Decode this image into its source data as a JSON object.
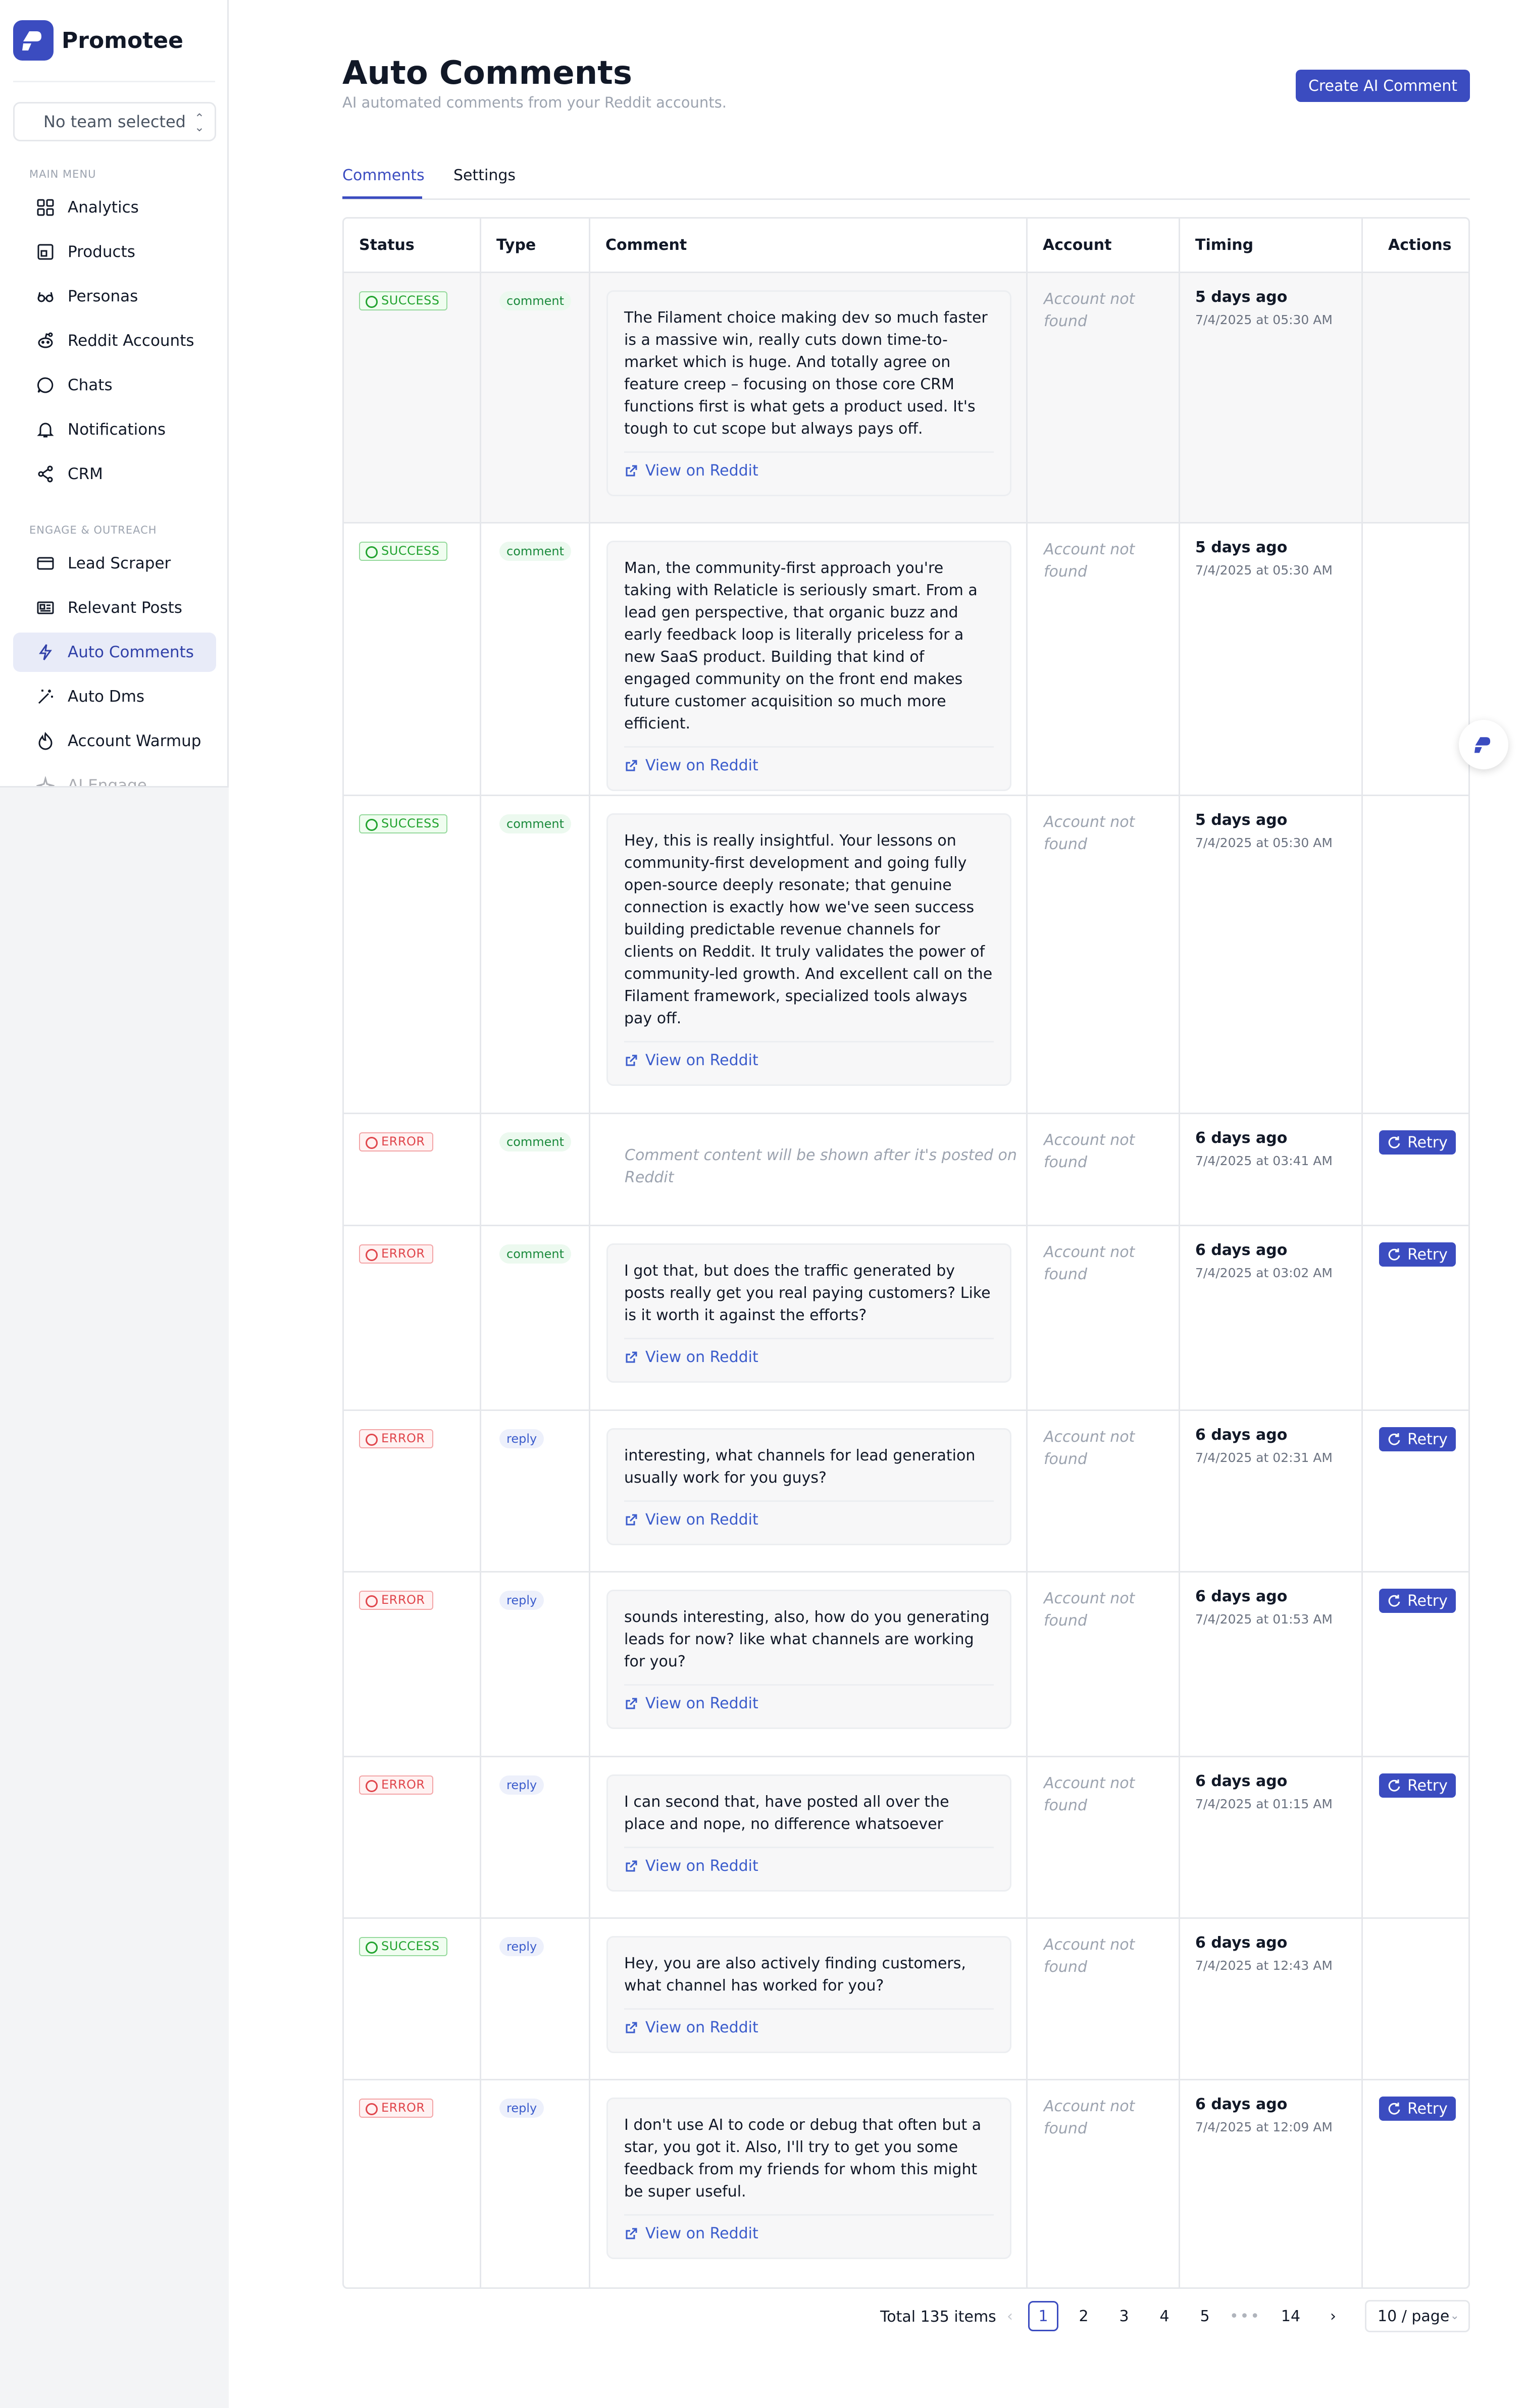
{
  "app": {
    "name": "Promotee"
  },
  "team_selector": {
    "value": "No team selected"
  },
  "sidebar": {
    "main_menu_label": "MAIN MENU",
    "engage_label": "ENGAGE & OUTREACH",
    "items": [
      {
        "label": "Analytics",
        "icon": "grid-icon"
      },
      {
        "label": "Products",
        "icon": "box-icon"
      },
      {
        "label": "Personas",
        "icon": "glasses-icon"
      },
      {
        "label": "Reddit Accounts",
        "icon": "reddit-icon"
      },
      {
        "label": "Chats",
        "icon": "chat-bubble-icon"
      },
      {
        "label": "Notifications",
        "icon": "bell-icon"
      },
      {
        "label": "CRM",
        "icon": "share-nodes-icon"
      },
      {
        "label": "Lead Scraper",
        "icon": "credit-card-icon"
      },
      {
        "label": "Relevant Posts",
        "icon": "news-icon"
      },
      {
        "label": "Auto Comments",
        "icon": "bolt-icon"
      },
      {
        "label": "Auto Dms",
        "icon": "magic-wand-icon"
      },
      {
        "label": "Account Warmup",
        "icon": "flame-icon"
      },
      {
        "label": "AI Engage",
        "icon": "sparkle-icon"
      }
    ]
  },
  "page": {
    "title": "Auto Comments",
    "subtitle": "AI automated comments from your Reddit accounts.",
    "create_button": "Create AI Comment",
    "tabs": [
      "Comments",
      "Settings"
    ]
  },
  "table": {
    "headers": [
      "Status",
      "Type",
      "Comment",
      "Account",
      "Timing",
      "Actions"
    ],
    "link_label": "View on Reddit",
    "retry_label": "Retry",
    "rows": [
      {
        "status": "SUCCESS",
        "type": "comment",
        "comment": "The Filament choice making dev so much faster is a massive win, really cuts down time-to-market which is huge. And totally agree on feature creep – focusing on those core CRM functions first is what gets a product used. It's tough to cut scope but always pays off.",
        "account": "Account not found",
        "relative": "5 days ago",
        "absolute": "7/4/2025 at 05:30 AM"
      },
      {
        "status": "SUCCESS",
        "type": "comment",
        "comment": "Man, the community-first approach you're taking with Relaticle is seriously smart. From a lead gen perspective, that organic buzz and early feedback loop is literally priceless for a new SaaS product. Building that kind of engaged community on the front end makes future customer acquisition so much more efficient.",
        "account": "Account not found",
        "relative": "5 days ago",
        "absolute": "7/4/2025 at 05:30 AM"
      },
      {
        "status": "SUCCESS",
        "type": "comment",
        "comment": "Hey, this is really insightful. Your lessons on community-first development and going fully open-source deeply resonate; that genuine connection is exactly how we've seen success building predictable revenue channels for clients on Reddit. It truly validates the power of community-led growth. And excellent call on the Filament framework, specialized tools always pay off.",
        "account": "Account not found",
        "relative": "5 days ago",
        "absolute": "7/4/2025 at 05:30 AM"
      },
      {
        "status": "ERROR",
        "type": "comment",
        "placeholder": "Comment content will be shown after it's posted on Reddit",
        "account": "Account not found",
        "relative": "6 days ago",
        "absolute": "7/4/2025 at 03:41 AM"
      },
      {
        "status": "ERROR",
        "type": "comment",
        "comment": "I got that, but does the traffic generated by posts really get you real paying customers? Like is it worth it against the efforts?",
        "account": "Account not found",
        "relative": "6 days ago",
        "absolute": "7/4/2025 at 03:02 AM"
      },
      {
        "status": "ERROR",
        "type": "reply",
        "comment": "interesting, what channels for lead generation usually work for you guys?",
        "account": "Account not found",
        "relative": "6 days ago",
        "absolute": "7/4/2025 at 02:31 AM"
      },
      {
        "status": "ERROR",
        "type": "reply",
        "comment": "sounds interesting, also, how do you generating leads for now? like what channels are working for you?",
        "account": "Account not found",
        "relative": "6 days ago",
        "absolute": "7/4/2025 at 01:53 AM"
      },
      {
        "status": "ERROR",
        "type": "reply",
        "comment": "I can second that, have posted all over the place and nope, no difference whatsoever",
        "account": "Account not found",
        "relative": "6 days ago",
        "absolute": "7/4/2025 at 01:15 AM"
      },
      {
        "status": "SUCCESS",
        "type": "reply",
        "comment": "Hey, you are also actively finding customers, what channel has worked for you?",
        "account": "Account not found",
        "relative": "6 days ago",
        "absolute": "7/4/2025 at 12:43 AM"
      },
      {
        "status": "ERROR",
        "type": "reply",
        "comment": "I don't use AI to code or debug that often but a star, you got it. Also, I'll try to get you some feedback from my friends for whom this might be super useful.",
        "account": "Account not found",
        "relative": "6 days ago",
        "absolute": "7/4/2025 at 12:09 AM"
      }
    ]
  },
  "pagination": {
    "total": "Total 135 items",
    "pages": [
      "1",
      "2",
      "3",
      "4",
      "5",
      "•••",
      "14"
    ],
    "current_page": 1,
    "per_page": "10 / page"
  },
  "colors": {
    "accent": "#3b4cc0",
    "success": "#22a32f",
    "error": "#e0464c",
    "link": "#3b5ccc"
  }
}
